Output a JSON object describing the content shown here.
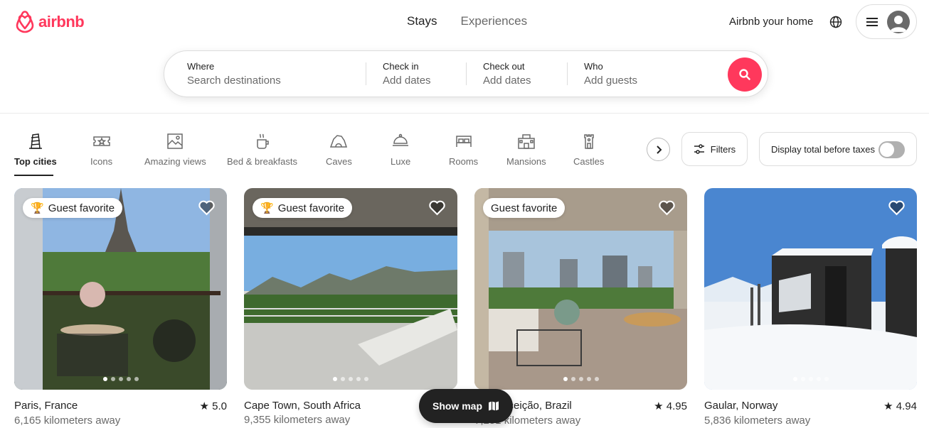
{
  "brand": {
    "name": "airbnb",
    "color": "#ff385c"
  },
  "topnav": {
    "stays": "Stays",
    "experiences": "Experiences"
  },
  "header": {
    "host_link": "Airbnb your home"
  },
  "search": {
    "where_label": "Where",
    "where_placeholder": "Search destinations",
    "checkin_label": "Check in",
    "checkin_value": "Add dates",
    "checkout_label": "Check out",
    "checkout_value": "Add dates",
    "who_label": "Who",
    "who_value": "Add guests"
  },
  "categories": [
    {
      "label": "Top cities",
      "icon": "tower-icon",
      "active": true
    },
    {
      "label": "Icons",
      "icon": "ticket-icon"
    },
    {
      "label": "Amazing views",
      "icon": "picture-icon"
    },
    {
      "label": "Bed & breakfasts",
      "icon": "coffee-icon"
    },
    {
      "label": "Caves",
      "icon": "cave-icon"
    },
    {
      "label": "Luxe",
      "icon": "cloche-icon"
    },
    {
      "label": "Rooms",
      "icon": "bed-icon"
    },
    {
      "label": "Mansions",
      "icon": "mansion-icon"
    },
    {
      "label": "Castles",
      "icon": "castle-icon"
    }
  ],
  "filters": {
    "label": "Filters"
  },
  "tax_toggle": {
    "label": "Display total before taxes",
    "on": false
  },
  "listings": [
    {
      "badge": "Guest favorite",
      "badge_trophy": true,
      "title": "Paris, France",
      "rating": "5.0",
      "distance": "6,165 kilometers away"
    },
    {
      "badge": "Guest favorite",
      "badge_trophy": true,
      "title": "Cape Town, South Africa",
      "rating": "",
      "distance": "9,355 kilometers away"
    },
    {
      "badge": "Guest favorite",
      "badge_trophy": false,
      "title": "va Conceição, Brazil",
      "rating": "4.95",
      "distance": "7,251 kilometers away"
    },
    {
      "badge": "",
      "badge_trophy": false,
      "title": "Gaular, Norway",
      "rating": "4.94",
      "distance": "5,836 kilometers away"
    }
  ],
  "show_map": {
    "label": "Show map"
  }
}
